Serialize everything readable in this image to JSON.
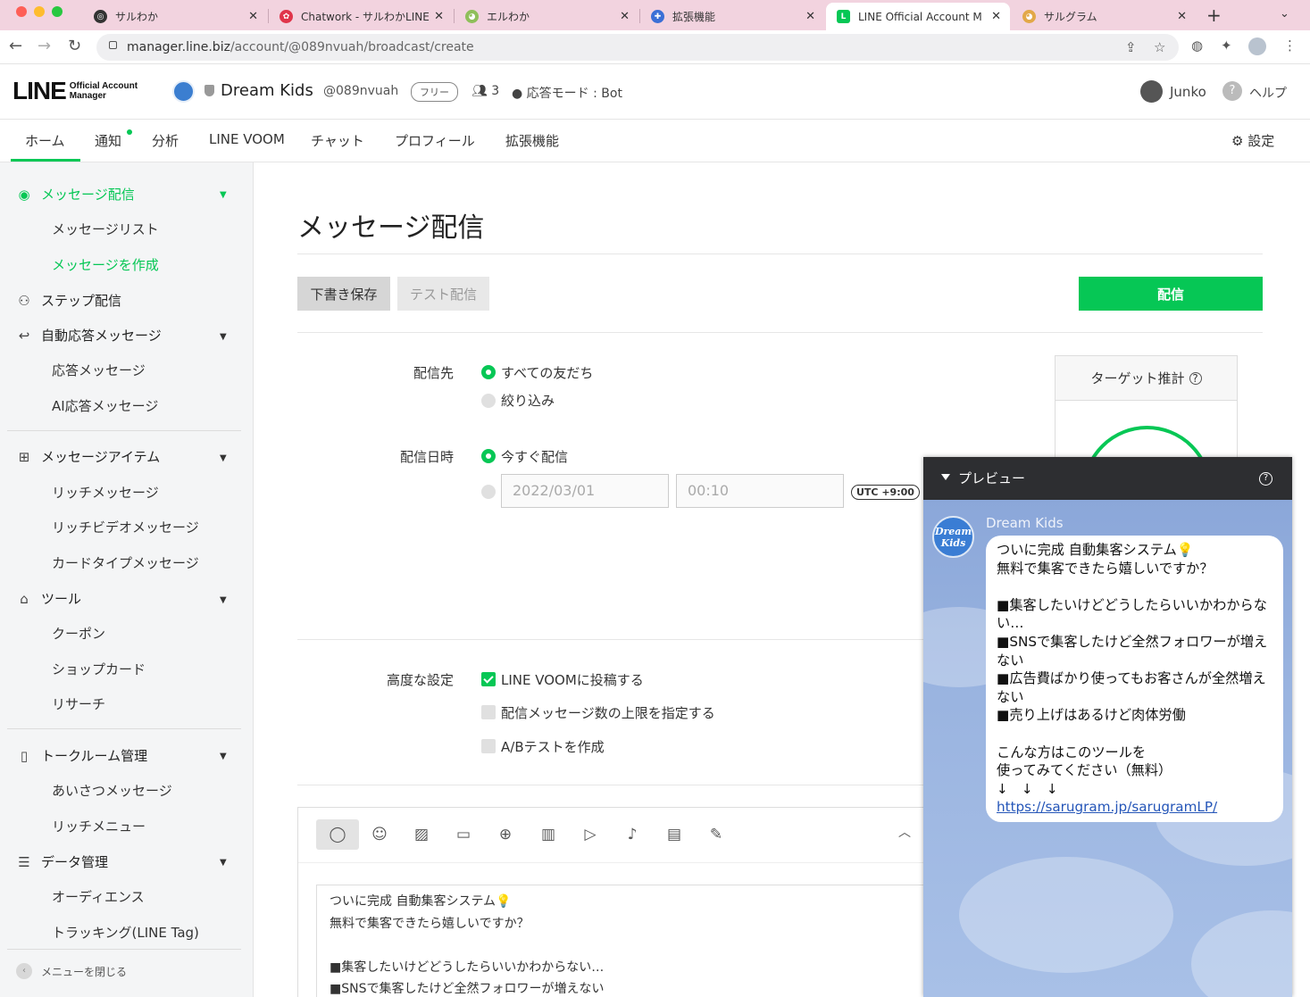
{
  "browser": {
    "tabs": [
      {
        "title": "サルわか",
        "icon": "globe-icon",
        "color": "#333333"
      },
      {
        "title": "Chatwork - サルわかLINE",
        "icon": "chatwork-icon",
        "color": "#e0344a"
      },
      {
        "title": "エルわか",
        "icon": "monkey-icon",
        "color": "#8fbf5a"
      },
      {
        "title": "拡張機能",
        "icon": "puzzle-icon",
        "color": "#3b6fd6"
      },
      {
        "title": "LINE Official Account M",
        "icon": "line-oa-icon",
        "color": "#06c755",
        "active": true
      },
      {
        "title": "サルグラム",
        "icon": "monkey-icon",
        "color": "#e2a848"
      }
    ],
    "new_tab": "+",
    "url_host": "manager.line.biz",
    "url_path": "/account/@089nvuah/broadcast/create"
  },
  "header": {
    "logo_big": "LINE",
    "logo_small_1": "Official Account",
    "logo_small_2": "Manager",
    "account_name": "Dream Kids",
    "account_id": "@089nvuah",
    "plan": "フリー",
    "friends_count": "3",
    "response_mode": "応答モード : Bot",
    "user_name": "Junko",
    "help": "ヘルプ"
  },
  "topnav": {
    "items": [
      "ホーム",
      "通知",
      "分析",
      "LINE VOOM",
      "チャット",
      "プロフィール",
      "拡張機能"
    ],
    "active": "ホーム",
    "settings": "設定",
    "accent": "#06c755"
  },
  "sidebar": {
    "broadcast": "メッセージ配信",
    "message_list": "メッセージリスト",
    "create_message": "メッセージを作成",
    "step": "ステップ配信",
    "auto_reply": "自動応答メッセージ",
    "reply_message": "応答メッセージ",
    "ai_reply": "AI応答メッセージ",
    "message_items": "メッセージアイテム",
    "rich_message": "リッチメッセージ",
    "rich_video": "リッチビデオメッセージ",
    "card_type": "カードタイプメッセージ",
    "tools": "ツール",
    "coupon": "クーポン",
    "shop_card": "ショップカード",
    "research": "リサーチ",
    "talkroom": "トークルーム管理",
    "greeting": "あいさつメッセージ",
    "rich_menu": "リッチメニュー",
    "data_mgmt": "データ管理",
    "audience": "オーディエンス",
    "tracking": "トラッキング(LINE Tag)",
    "close_menu": "メニューを閉じる"
  },
  "main": {
    "title": "メッセージ配信",
    "btn_draft": "下書き保存",
    "btn_test": "テスト配信",
    "btn_send": "配信",
    "recipients_label": "配信先",
    "recipients_all": "すべての友だち",
    "recipients_filter": "絞り込み",
    "datetime_label": "配信日時",
    "send_now": "今すぐ配信",
    "date_value": "2022/03/01",
    "time_value": "00:10",
    "timezone": "UTC +9:00",
    "target_estimate": "ターゲット推計",
    "advanced_label": "高度な設定",
    "post_voom": "LINE VOOMに投稿する",
    "limit_messages": "配信メッセージ数の上限を指定する",
    "ab_test": "A/Bテストを作成",
    "editor_text": "ついに完成 自動集客システム💡\n無料で集客できたら嬉しいですか？\n\n■集客したいけどどうしたらいいかわからない…\n■SNSで集客したけど全然フォロワーが増えない"
  },
  "preview": {
    "title": "プレビュー",
    "sender": "Dream Kids",
    "avatar_text": "Dream Kids",
    "message": "ついに完成 自動集客システム💡\n無料で集客できたら嬉しいですか？\n\n■集客したいけどどうしたらいいかわからない…\n■SNSで集客したけど全然フォロワーが増えない\n■広告費ばかり使ってもお客さんが全然増えない\n■売り上げはあるけど肉体労働\n\nこんな方はこのツールを\n使ってみてください（無料）\n↓　↓　↓",
    "link": "https://sarugram.jp/sarugramLP/"
  }
}
